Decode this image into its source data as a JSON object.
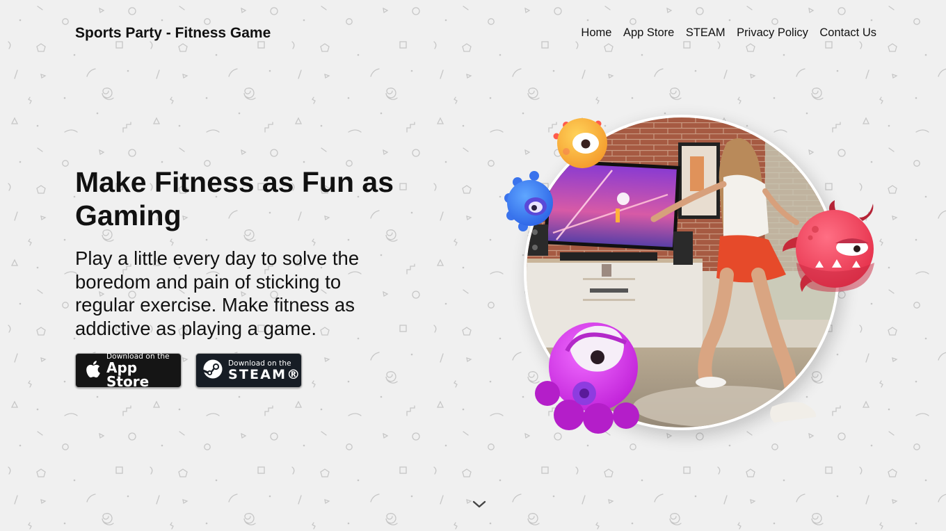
{
  "header": {
    "brand": "Sports Party - Fitness Game",
    "nav": [
      {
        "label": "Home"
      },
      {
        "label": "App Store"
      },
      {
        "label": "STEAM"
      },
      {
        "label": "Privacy Policy"
      },
      {
        "label": "Contact Us"
      }
    ]
  },
  "hero": {
    "title": "Make Fitness as Fun as Gaming",
    "subtitle": "Play a little every day to solve the boredom and pain of sticking to regular exercise. Make fitness as addictive as playing a game.",
    "badges": {
      "appstore": {
        "small": "Download on the",
        "big": "App Store",
        "icon": "apple-icon"
      },
      "steam": {
        "small": "Download on the",
        "big": "STEAM®",
        "icon": "steam-icon"
      }
    },
    "image": {
      "alt": "Woman playing a motion fitness game in front of a TV, surrounded by cartoon monsters",
      "monsters": [
        "orange-cyclops",
        "blue-spiky",
        "red-horned",
        "purple-octopus"
      ]
    }
  },
  "scroll_indicator": {
    "icon": "chevron-down-icon"
  },
  "colors": {
    "background": "#f0f0f0",
    "text": "#111111",
    "appstore_badge": "#151515",
    "steam_badge": "#171d25",
    "pattern": "#c4c4c4"
  }
}
